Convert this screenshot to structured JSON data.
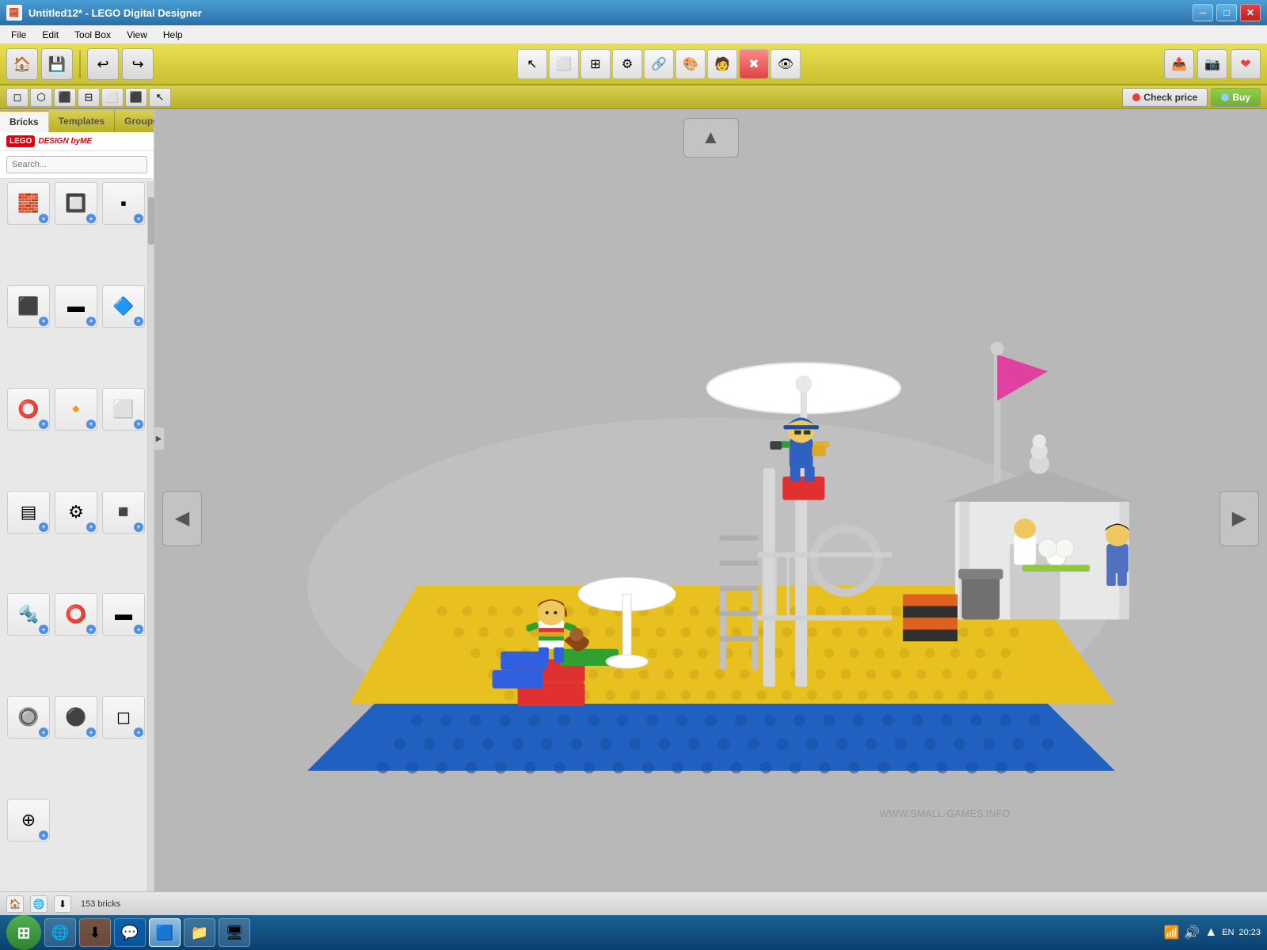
{
  "window": {
    "title": "Untitled12* - LEGO Digital Designer",
    "icon": "🟥"
  },
  "menu": {
    "items": [
      "File",
      "Edit",
      "Tool Box",
      "View",
      "Help"
    ]
  },
  "toolbar": {
    "left_buttons": [
      {
        "name": "new-button",
        "icon": "🏠",
        "label": "New"
      },
      {
        "name": "save-button",
        "icon": "💾",
        "label": "Save"
      }
    ],
    "undo_redo": [
      {
        "name": "undo-button",
        "icon": "↩",
        "label": "Undo"
      },
      {
        "name": "redo-button",
        "icon": "↪",
        "label": "Redo"
      }
    ],
    "center_tools": [
      {
        "name": "select-tool",
        "icon": "↖",
        "label": "Select"
      },
      {
        "name": "move-tool",
        "icon": "⬜",
        "label": "Move"
      },
      {
        "name": "clone-tool",
        "icon": "⊞",
        "label": "Clone"
      },
      {
        "name": "hinge-tool",
        "icon": "⚙",
        "label": "Hinge"
      },
      {
        "name": "flex-tool",
        "icon": "🔗",
        "label": "Flex"
      },
      {
        "name": "paint-tool",
        "icon": "🎨",
        "label": "Paint"
      },
      {
        "name": "minifig-tool",
        "icon": "🧑",
        "label": "Minifig"
      },
      {
        "name": "delete-tool",
        "icon": "✖",
        "label": "Delete"
      },
      {
        "name": "hide-tool",
        "icon": "👁",
        "label": "Hide"
      }
    ],
    "right_buttons": [
      {
        "name": "share-button",
        "icon": "📤",
        "label": "Share"
      },
      {
        "name": "snapshot-button",
        "icon": "📷",
        "label": "Snapshot"
      },
      {
        "name": "wishlist-button",
        "icon": "❤",
        "label": "Wishlist"
      }
    ]
  },
  "secondary_toolbar": {
    "view_buttons": [
      {
        "name": "view1",
        "icon": "◻"
      },
      {
        "name": "view2",
        "icon": "⬡"
      },
      {
        "name": "view3",
        "icon": "⬛"
      },
      {
        "name": "view4",
        "icon": "⊟"
      },
      {
        "name": "view5",
        "icon": "⬜"
      },
      {
        "name": "view6",
        "icon": "⬛"
      },
      {
        "name": "view-cursor",
        "icon": "↖"
      }
    ],
    "check_price_label": "Check price",
    "buy_label": "Buy",
    "price_dot_color": "#e84040",
    "buy_dot_color": "#5090e0"
  },
  "left_panel": {
    "tabs": [
      {
        "name": "bricks-tab",
        "label": "Bricks",
        "active": true
      },
      {
        "name": "templates-tab",
        "label": "Templates",
        "active": false
      },
      {
        "name": "groups-tab",
        "label": "Groups",
        "active": false
      }
    ],
    "search_placeholder": "Search...",
    "bricks": [
      {
        "id": 1,
        "icon": "🧱"
      },
      {
        "id": 2,
        "icon": "🔲"
      },
      {
        "id": 3,
        "icon": "▪"
      },
      {
        "id": 4,
        "icon": "⬛"
      },
      {
        "id": 5,
        "icon": "▬"
      },
      {
        "id": 6,
        "icon": "🔷"
      },
      {
        "id": 7,
        "icon": "⭕"
      },
      {
        "id": 8,
        "icon": "🔸"
      },
      {
        "id": 9,
        "icon": "⬜"
      },
      {
        "id": 10,
        "icon": "▤"
      },
      {
        "id": 11,
        "icon": "⚙"
      },
      {
        "id": 12,
        "icon": "◾"
      },
      {
        "id": 13,
        "icon": "🔩"
      },
      {
        "id": 14,
        "icon": "⭕"
      },
      {
        "id": 15,
        "icon": "▬"
      },
      {
        "id": 16,
        "icon": "🔘"
      },
      {
        "id": 17,
        "icon": "⚫"
      },
      {
        "id": 18,
        "icon": "◻"
      },
      {
        "id": 19,
        "icon": "⊕"
      },
      {
        "id": 20,
        "icon": "⊙"
      },
      {
        "id": 21,
        "icon": "⬜"
      }
    ]
  },
  "canvas": {
    "nav_arrows": {
      "up": "▲",
      "down": "▼",
      "left": "◀",
      "right": "▶"
    }
  },
  "status_bar": {
    "brick_count": "153 bricks",
    "icons": [
      "🏠",
      "🌐",
      "⬇"
    ]
  },
  "taskbar": {
    "start_icon": "⊞",
    "apps": [
      {
        "name": "chrome-app",
        "icon": "🌐"
      },
      {
        "name": "torrent-app",
        "icon": "⬇"
      },
      {
        "name": "skype-app",
        "icon": "💬"
      },
      {
        "name": "lego-app",
        "icon": "🟦",
        "active": true
      },
      {
        "name": "folder-app",
        "icon": "📁"
      },
      {
        "name": "explorer-app",
        "icon": "🖥"
      }
    ],
    "tray": {
      "lang": "EN",
      "time": "20:23",
      "icons": [
        "🔊",
        "🌐",
        "📶"
      ]
    }
  }
}
